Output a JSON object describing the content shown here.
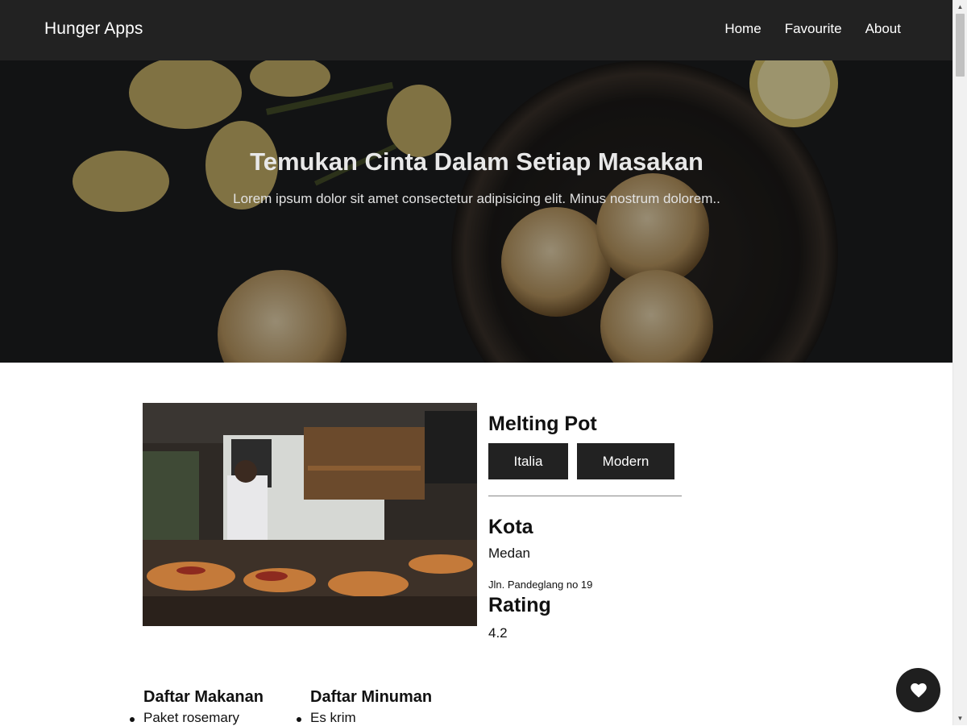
{
  "header": {
    "brand": "Hunger Apps",
    "nav": [
      "Home",
      "Favourite",
      "About"
    ]
  },
  "hero": {
    "title": "Temukan Cinta Dalam Setiap Masakan",
    "subtitle": "Lorem ipsum dolor sit amet consectetur adipisicing elit. Minus nostrum dolorem.."
  },
  "restaurant": {
    "name": "Melting Pot",
    "categories": [
      "Italia",
      "Modern"
    ],
    "city_label": "Kota",
    "city": "Medan",
    "address": "Jln. Pandeglang no 19",
    "rating_label": "Rating",
    "rating": "4.2"
  },
  "menus": {
    "foods_title": "Daftar Makanan",
    "foods": [
      "Paket rosemary"
    ],
    "drinks_title": "Daftar Minuman",
    "drinks": [
      "Es krim"
    ]
  },
  "fab": {
    "icon": "heart-icon"
  },
  "colors": {
    "header_bg": "#222222",
    "tag_bg": "#222222",
    "fab_bg": "#1f1f1f"
  }
}
